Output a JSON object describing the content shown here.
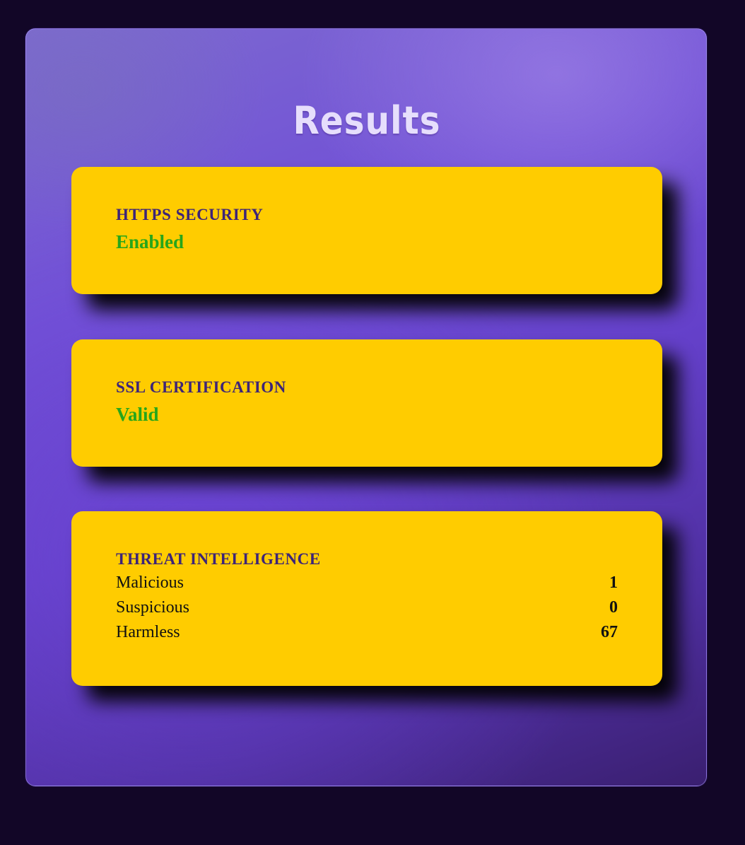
{
  "page": {
    "title": "Results"
  },
  "cards": {
    "https": {
      "label": "HTTPS SECURITY",
      "value": "Enabled"
    },
    "ssl": {
      "label": "SSL CERTIFICATION",
      "value": "Valid"
    },
    "threat": {
      "label": "THREAT INTELLIGENCE",
      "rows": [
        {
          "name": "Malicious",
          "count": "1"
        },
        {
          "name": "Suspicious",
          "count": "0"
        },
        {
          "name": "Harmless",
          "count": "67"
        }
      ]
    }
  },
  "colors": {
    "card_background": "#ffcc00",
    "label_text": "#3d2478",
    "status_ok": "#27a61a",
    "page_background": "#120627",
    "title_text": "#e6defc"
  }
}
